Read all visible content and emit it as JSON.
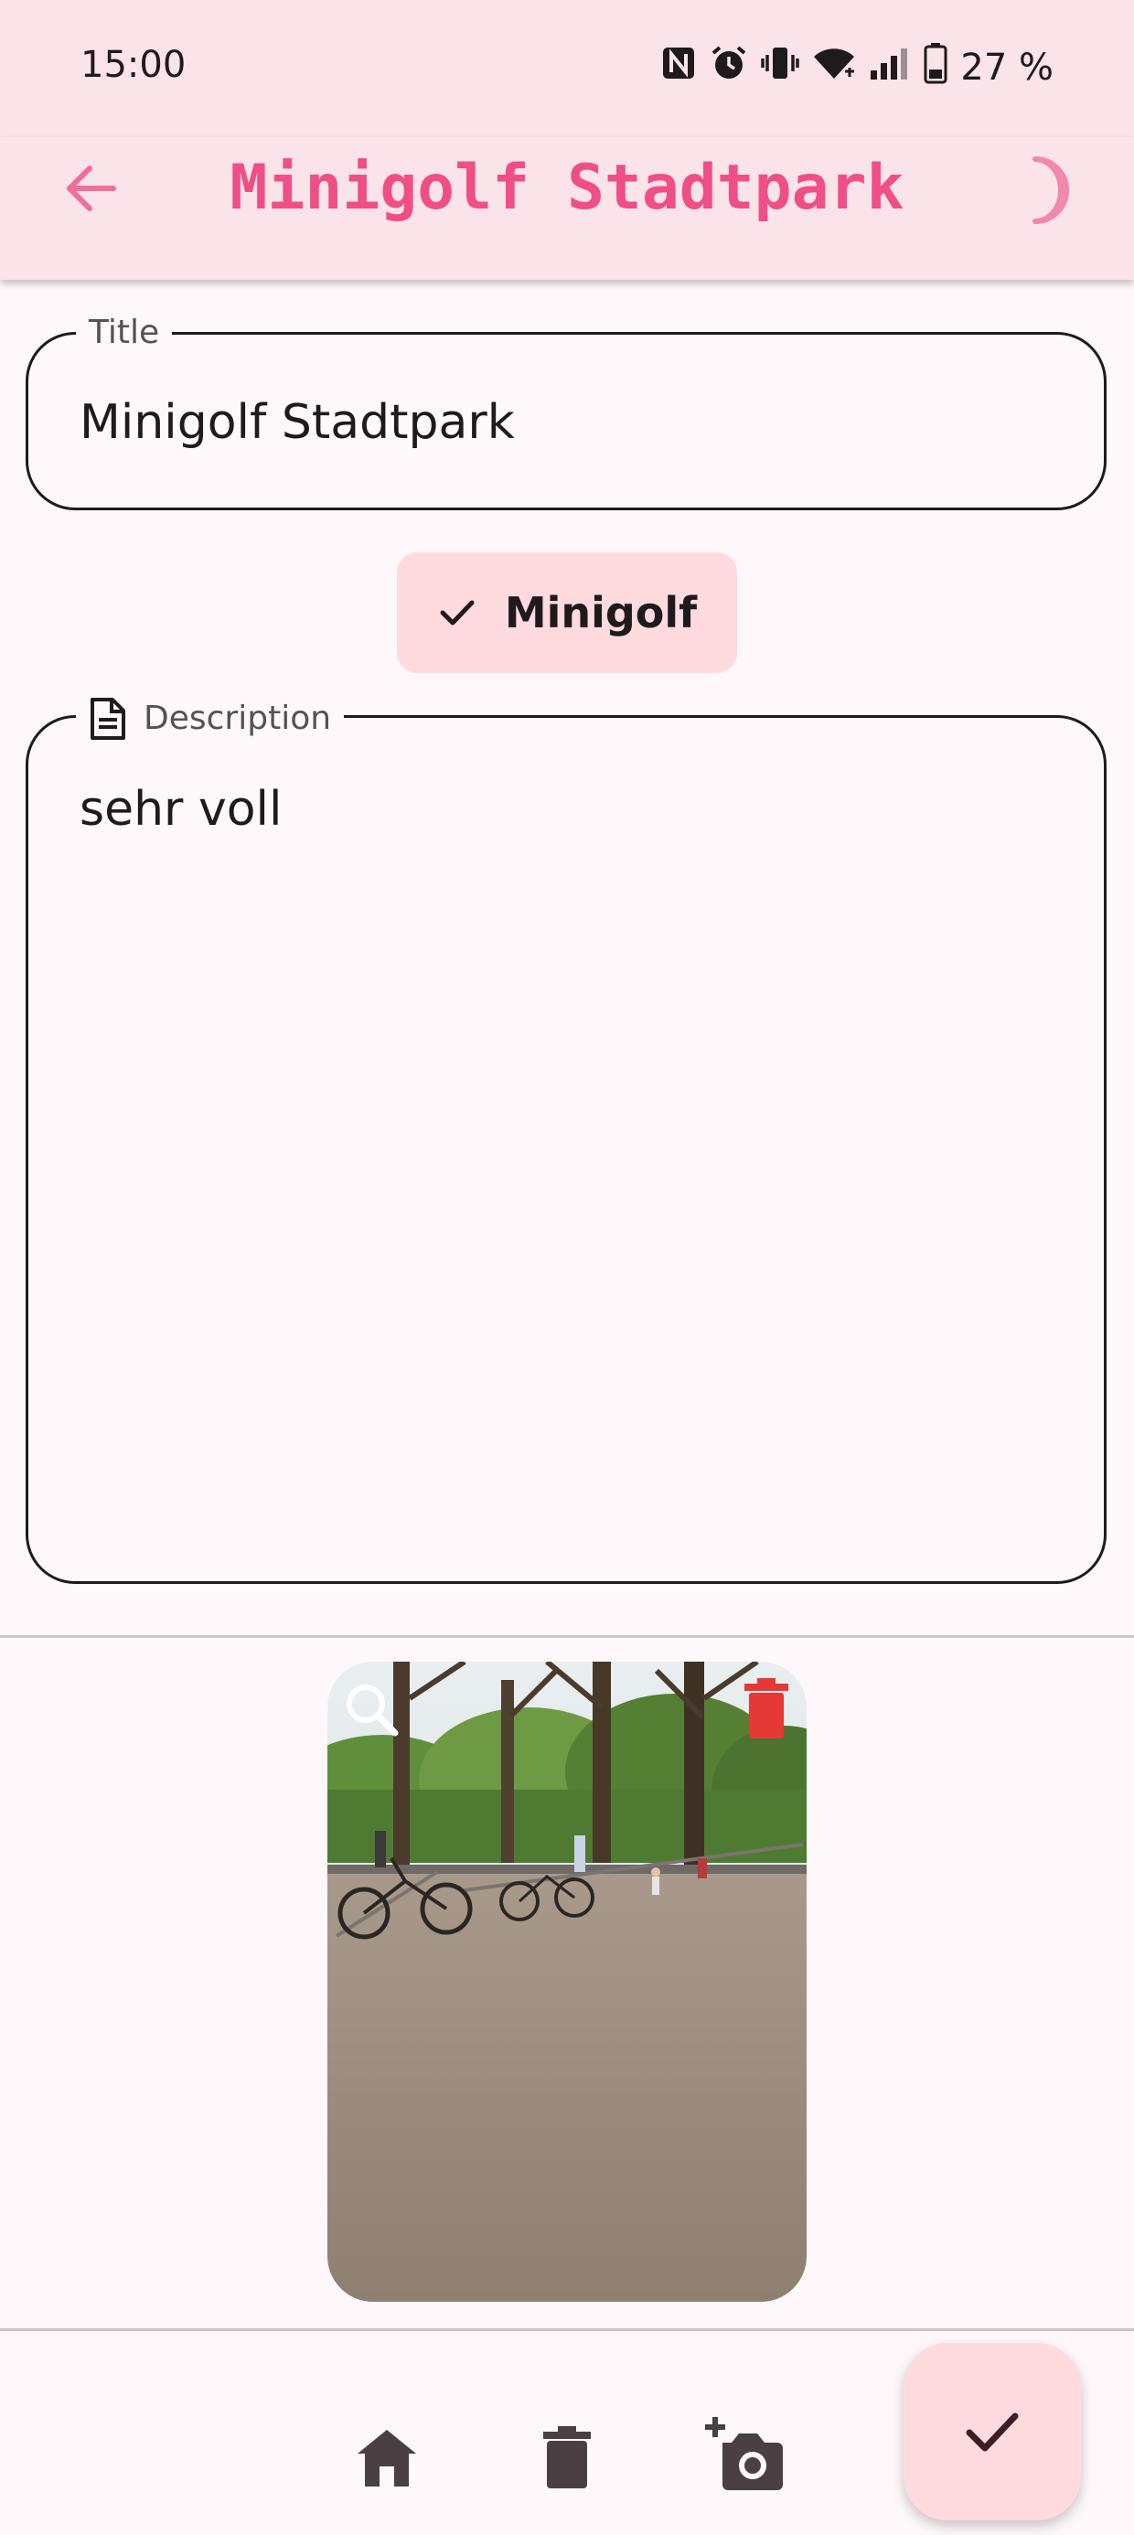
{
  "status_bar": {
    "time": "15:00",
    "icons": [
      "nfc-icon",
      "alarm-icon",
      "vibrate-icon",
      "wifi-icon",
      "cell-signal-icon",
      "battery-icon"
    ],
    "battery": "27 %"
  },
  "app_bar": {
    "title": "Minigolf Stadtpark",
    "back_icon": "arrow-left-icon",
    "theme_icon": "moon-icon",
    "accent_color": "#ef4f86"
  },
  "form": {
    "title_label": "Title",
    "title_value": "Minigolf Stadtpark",
    "category_chip": {
      "label": "Minigolf",
      "selected": true
    },
    "description_label": "Description",
    "description_value": "sehr voll"
  },
  "photo": {
    "zoom_icon": "zoom-icon",
    "delete_icon": "delete-icon",
    "delete_color": "#e53935"
  },
  "bottom_bar": {
    "items": [
      "home-icon",
      "trash-icon",
      "add-photo-icon"
    ],
    "fab_icon": "check-icon"
  }
}
